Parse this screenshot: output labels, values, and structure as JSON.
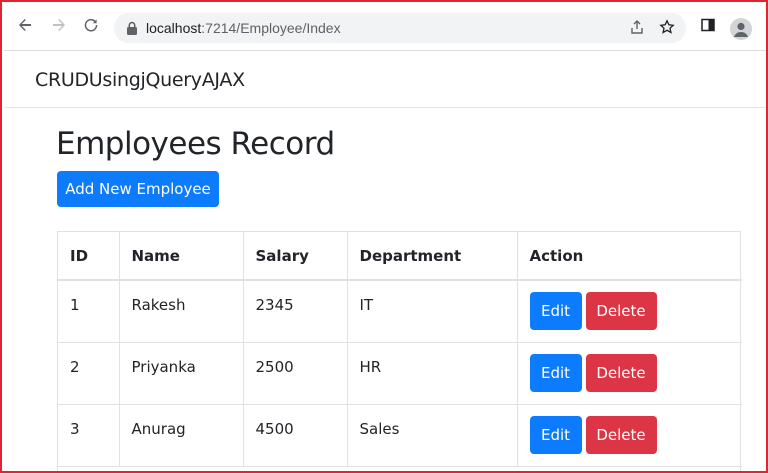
{
  "browser": {
    "url_host": "localhost",
    "url_path": ":7214/Employee/Index"
  },
  "navbar": {
    "brand": "CRUDUsingjQueryAJAX"
  },
  "page": {
    "title": "Employees Record",
    "add_button_label": "Add New Employee"
  },
  "table": {
    "headers": [
      "ID",
      "Name",
      "Salary",
      "Department",
      "Action"
    ],
    "rows": [
      {
        "id": "1",
        "name": "Rakesh",
        "salary": "2345",
        "department": "IT"
      },
      {
        "id": "2",
        "name": "Priyanka",
        "salary": "2500",
        "department": "HR"
      },
      {
        "id": "3",
        "name": "Anurag",
        "salary": "4500",
        "department": "Sales"
      }
    ],
    "edit_label": "Edit",
    "delete_label": "Delete"
  },
  "colors": {
    "primary": "#0d7bfd",
    "danger": "#dc3545",
    "frame": "#e0252f"
  }
}
